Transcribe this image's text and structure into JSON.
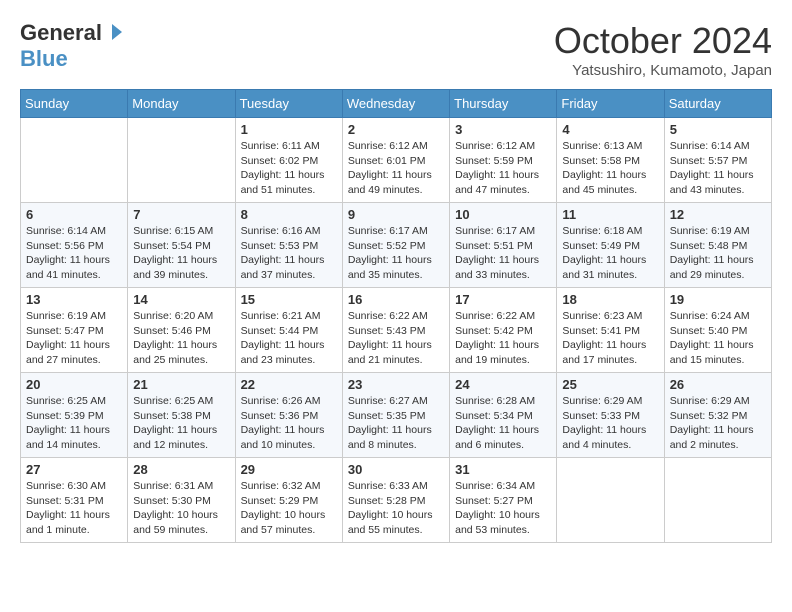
{
  "header": {
    "logo_general": "General",
    "logo_blue": "Blue",
    "month_year": "October 2024",
    "location": "Yatsushiro, Kumamoto, Japan"
  },
  "days_of_week": [
    "Sunday",
    "Monday",
    "Tuesday",
    "Wednesday",
    "Thursday",
    "Friday",
    "Saturday"
  ],
  "weeks": [
    [
      {
        "day": "",
        "detail": ""
      },
      {
        "day": "",
        "detail": ""
      },
      {
        "day": "1",
        "detail": "Sunrise: 6:11 AM\nSunset: 6:02 PM\nDaylight: 11 hours and 51 minutes."
      },
      {
        "day": "2",
        "detail": "Sunrise: 6:12 AM\nSunset: 6:01 PM\nDaylight: 11 hours and 49 minutes."
      },
      {
        "day": "3",
        "detail": "Sunrise: 6:12 AM\nSunset: 5:59 PM\nDaylight: 11 hours and 47 minutes."
      },
      {
        "day": "4",
        "detail": "Sunrise: 6:13 AM\nSunset: 5:58 PM\nDaylight: 11 hours and 45 minutes."
      },
      {
        "day": "5",
        "detail": "Sunrise: 6:14 AM\nSunset: 5:57 PM\nDaylight: 11 hours and 43 minutes."
      }
    ],
    [
      {
        "day": "6",
        "detail": "Sunrise: 6:14 AM\nSunset: 5:56 PM\nDaylight: 11 hours and 41 minutes."
      },
      {
        "day": "7",
        "detail": "Sunrise: 6:15 AM\nSunset: 5:54 PM\nDaylight: 11 hours and 39 minutes."
      },
      {
        "day": "8",
        "detail": "Sunrise: 6:16 AM\nSunset: 5:53 PM\nDaylight: 11 hours and 37 minutes."
      },
      {
        "day": "9",
        "detail": "Sunrise: 6:17 AM\nSunset: 5:52 PM\nDaylight: 11 hours and 35 minutes."
      },
      {
        "day": "10",
        "detail": "Sunrise: 6:17 AM\nSunset: 5:51 PM\nDaylight: 11 hours and 33 minutes."
      },
      {
        "day": "11",
        "detail": "Sunrise: 6:18 AM\nSunset: 5:49 PM\nDaylight: 11 hours and 31 minutes."
      },
      {
        "day": "12",
        "detail": "Sunrise: 6:19 AM\nSunset: 5:48 PM\nDaylight: 11 hours and 29 minutes."
      }
    ],
    [
      {
        "day": "13",
        "detail": "Sunrise: 6:19 AM\nSunset: 5:47 PM\nDaylight: 11 hours and 27 minutes."
      },
      {
        "day": "14",
        "detail": "Sunrise: 6:20 AM\nSunset: 5:46 PM\nDaylight: 11 hours and 25 minutes."
      },
      {
        "day": "15",
        "detail": "Sunrise: 6:21 AM\nSunset: 5:44 PM\nDaylight: 11 hours and 23 minutes."
      },
      {
        "day": "16",
        "detail": "Sunrise: 6:22 AM\nSunset: 5:43 PM\nDaylight: 11 hours and 21 minutes."
      },
      {
        "day": "17",
        "detail": "Sunrise: 6:22 AM\nSunset: 5:42 PM\nDaylight: 11 hours and 19 minutes."
      },
      {
        "day": "18",
        "detail": "Sunrise: 6:23 AM\nSunset: 5:41 PM\nDaylight: 11 hours and 17 minutes."
      },
      {
        "day": "19",
        "detail": "Sunrise: 6:24 AM\nSunset: 5:40 PM\nDaylight: 11 hours and 15 minutes."
      }
    ],
    [
      {
        "day": "20",
        "detail": "Sunrise: 6:25 AM\nSunset: 5:39 PM\nDaylight: 11 hours and 14 minutes."
      },
      {
        "day": "21",
        "detail": "Sunrise: 6:25 AM\nSunset: 5:38 PM\nDaylight: 11 hours and 12 minutes."
      },
      {
        "day": "22",
        "detail": "Sunrise: 6:26 AM\nSunset: 5:36 PM\nDaylight: 11 hours and 10 minutes."
      },
      {
        "day": "23",
        "detail": "Sunrise: 6:27 AM\nSunset: 5:35 PM\nDaylight: 11 hours and 8 minutes."
      },
      {
        "day": "24",
        "detail": "Sunrise: 6:28 AM\nSunset: 5:34 PM\nDaylight: 11 hours and 6 minutes."
      },
      {
        "day": "25",
        "detail": "Sunrise: 6:29 AM\nSunset: 5:33 PM\nDaylight: 11 hours and 4 minutes."
      },
      {
        "day": "26",
        "detail": "Sunrise: 6:29 AM\nSunset: 5:32 PM\nDaylight: 11 hours and 2 minutes."
      }
    ],
    [
      {
        "day": "27",
        "detail": "Sunrise: 6:30 AM\nSunset: 5:31 PM\nDaylight: 11 hours and 1 minute."
      },
      {
        "day": "28",
        "detail": "Sunrise: 6:31 AM\nSunset: 5:30 PM\nDaylight: 10 hours and 59 minutes."
      },
      {
        "day": "29",
        "detail": "Sunrise: 6:32 AM\nSunset: 5:29 PM\nDaylight: 10 hours and 57 minutes."
      },
      {
        "day": "30",
        "detail": "Sunrise: 6:33 AM\nSunset: 5:28 PM\nDaylight: 10 hours and 55 minutes."
      },
      {
        "day": "31",
        "detail": "Sunrise: 6:34 AM\nSunset: 5:27 PM\nDaylight: 10 hours and 53 minutes."
      },
      {
        "day": "",
        "detail": ""
      },
      {
        "day": "",
        "detail": ""
      }
    ]
  ]
}
